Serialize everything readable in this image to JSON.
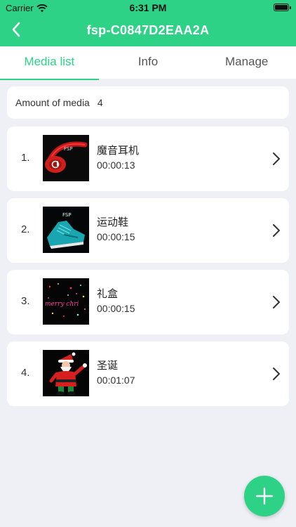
{
  "status_bar": {
    "carrier": "Carrier",
    "time": "6:31 PM"
  },
  "nav": {
    "title": "fsp-C0847D2EAA2A"
  },
  "tabs": [
    {
      "label": "Media list",
      "active": true
    },
    {
      "label": "Info",
      "active": false
    },
    {
      "label": "Manage",
      "active": false
    }
  ],
  "summary": {
    "label": "Amount of media",
    "count": "4"
  },
  "media": [
    {
      "index": "1.",
      "title": "魔音耳机",
      "duration": "00:00:13",
      "thumb_icon": "headphones-thumbnail"
    },
    {
      "index": "2.",
      "title": "运动鞋",
      "duration": "00:00:15",
      "thumb_icon": "sneaker-thumbnail"
    },
    {
      "index": "3.",
      "title": "礼盒",
      "duration": "00:00:15",
      "thumb_icon": "merry-christmas-thumbnail"
    },
    {
      "index": "4.",
      "title": "圣诞",
      "duration": "00:01:07",
      "thumb_icon": "santa-thumbnail"
    }
  ],
  "colors": {
    "accent": "#2dd286",
    "background": "#eef0f5",
    "card": "#ffffff"
  },
  "thumb_labels": {
    "headphones": "FSP",
    "sneaker": "FSP",
    "christmas": "merry chri"
  }
}
